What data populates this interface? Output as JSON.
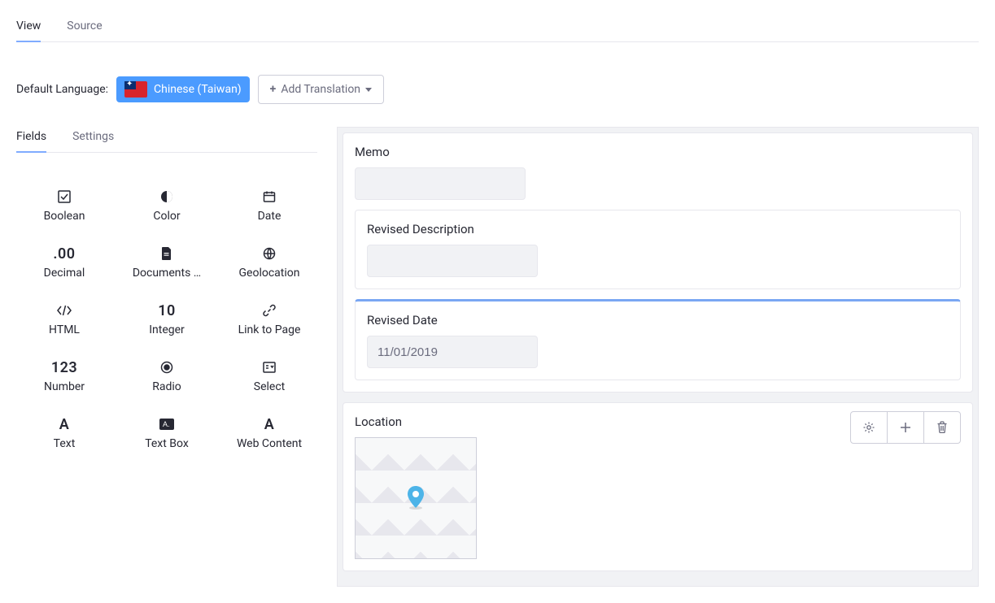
{
  "mainTabs": {
    "view": "View",
    "source": "Source"
  },
  "langRow": {
    "label": "Default Language:",
    "language": "Chinese (Taiwan)",
    "addTranslation": "Add Translation"
  },
  "subTabs": {
    "fields": "Fields",
    "settings": "Settings"
  },
  "fieldTypes": [
    {
      "key": "boolean",
      "label": "Boolean"
    },
    {
      "key": "color",
      "label": "Color"
    },
    {
      "key": "date",
      "label": "Date"
    },
    {
      "key": "decimal",
      "label": "Decimal"
    },
    {
      "key": "documents",
      "label": "Documents …"
    },
    {
      "key": "geolocation",
      "label": "Geolocation"
    },
    {
      "key": "html",
      "label": "HTML"
    },
    {
      "key": "integer",
      "label": "Integer"
    },
    {
      "key": "link",
      "label": "Link to Page"
    },
    {
      "key": "number",
      "label": "Number"
    },
    {
      "key": "radio",
      "label": "Radio"
    },
    {
      "key": "select",
      "label": "Select"
    },
    {
      "key": "text",
      "label": "Text"
    },
    {
      "key": "textbox",
      "label": "Text Box"
    },
    {
      "key": "webcontent",
      "label": "Web Content"
    }
  ],
  "form": {
    "memo": {
      "label": "Memo",
      "value": ""
    },
    "revisedDescription": {
      "label": "Revised Description",
      "value": ""
    },
    "revisedDate": {
      "label": "Revised Date",
      "value": "11/01/2019"
    },
    "location": {
      "label": "Location"
    }
  }
}
